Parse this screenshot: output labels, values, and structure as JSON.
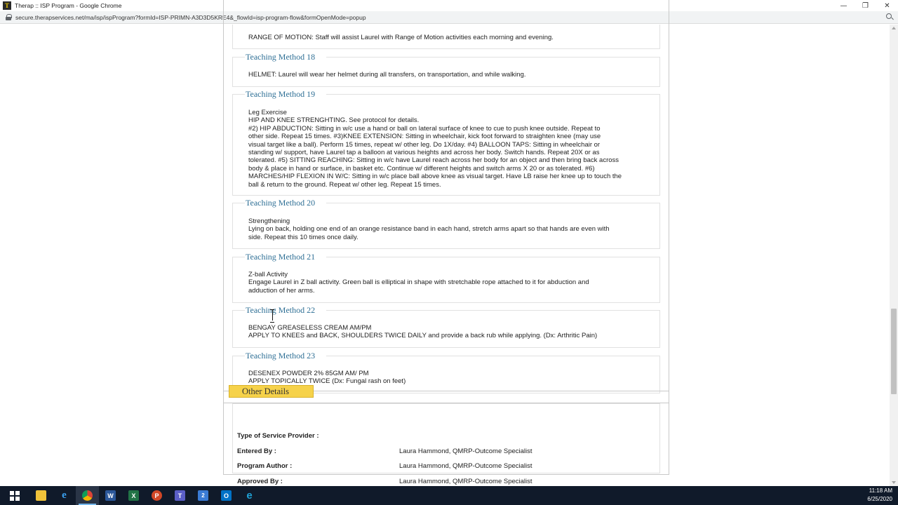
{
  "window": {
    "title": "Therap :: ISP Program - Google Chrome",
    "logo_letter": "T",
    "controls": [
      "—",
      "❐",
      "✕"
    ]
  },
  "address": {
    "url": "secure.therapservices.net/ma/isp/ispProgram?formId=ISP-PRIMN-A3D3D5KRE4&_flowId=isp-program-flow&formOpenMode=popup"
  },
  "teaching_methods": [
    {
      "text": [
        "RANGE OF MOTION: Staff will assist Laurel with Range of Motion activities each morning and evening."
      ]
    },
    {
      "title": "Teaching Method 18",
      "text": [
        "HELMET: Laurel will wear her helmet during all transfers, on transportation, and while walking."
      ]
    },
    {
      "title": "Teaching Method 19",
      "text": [
        "Leg Exercise",
        "HIP AND KNEE STRENGHTING. See protocol for details.",
        "#2) HIP ABDUCTION: Sitting in w/c use a hand or ball on lateral surface of knee to cue to push knee outside. Repeat to",
        "other side. Repeat 15 times. #3)KNEE EXTENSION: Sitting in wheelchair, kick foot forward to straighten knee (may use",
        "visual target like a ball). Perform 15 times, repeat w/ other leg. Do 1X/day. #4) BALLOON TAPS: Sitting in wheelchair or",
        "standing w/ support, have Laurel tap a balloon at various heights and across her body. Switch hands. Repeat 20X or as",
        "tolerated. #5) SITTING REACHING: Sitting in w/c have Laurel reach across her body for an object and then bring back across",
        "body & place in hand or surface, in basket etc. Continue w/ different heights and switch arms X 20 or as tolerated. #6)",
        "MARCHES/HIP FLEXION IN W/C: Sitting in w/c place ball above knee as visual target. Have LB raise her knee up to touch the",
        "ball & return to the ground. Repeat w/ other leg. Repeat 15 times."
      ]
    },
    {
      "title": "Teaching Method 20",
      "text": [
        "Strengthening",
        "Lying on back, holding one end of an orange resistance band in each hand, stretch arms apart so that hands are even with",
        "side. Repeat this 10 times once daily."
      ]
    },
    {
      "title": "Teaching Method 21",
      "text": [
        "Z-ball Activity",
        "Engage Laurel in Z ball activity. Green ball is elliptical in shape with stretchable rope attached to it for abduction and",
        "adduction of her arms."
      ]
    },
    {
      "title": "Teaching Method 22",
      "text": [
        "BENGAY GREASELESS CREAM AM/PM",
        "APPLY TO KNEES and BACK, SHOULDERS TWICE DAILY and provide a back rub while applying. (Dx: Arthritic Pain)"
      ]
    },
    {
      "title": "Teaching Method 23",
      "text": [
        "DESENEX POWDER 2% 85GM AM/ PM",
        "APPLY TOPICALLY TWICE (Dx: Fungal rash on feet)"
      ]
    }
  ],
  "other_details": {
    "title": "Other Details",
    "rows": [
      {
        "label": "Type of Service Provider :",
        "value": ""
      },
      {
        "label": "Entered By :",
        "value": "Laura Hammond, QMRP-Outcome Specialist"
      },
      {
        "label": "Program Author :",
        "value": "Laura Hammond, QMRP-Outcome Specialist"
      },
      {
        "label": "Approved By :",
        "value": "Laura Hammond, QMRP-Outcome Specialist"
      }
    ]
  },
  "taskbar": {
    "apps": [
      {
        "name": "file-explorer",
        "glyph": "",
        "color": "#f0c23a"
      },
      {
        "name": "internet-explorer",
        "glyph": "e",
        "color": "#1e90ff"
      },
      {
        "name": "chrome",
        "glyph": "",
        "color": "#db4437"
      },
      {
        "name": "word",
        "glyph": "W",
        "color": "#2b579a"
      },
      {
        "name": "excel",
        "glyph": "X",
        "color": "#217346"
      },
      {
        "name": "powerpoint",
        "glyph": "P",
        "color": "#d24726"
      },
      {
        "name": "teams",
        "glyph": "T",
        "color": "#5b5fc7"
      },
      {
        "name": "mail",
        "glyph": "2",
        "color": "#3a7bd5"
      },
      {
        "name": "outlook",
        "glyph": "O",
        "color": "#0072c6"
      },
      {
        "name": "edge",
        "glyph": "e",
        "color": "#1fa2d6"
      }
    ],
    "time": "11:18 AM",
    "date": "6/25/2020"
  }
}
